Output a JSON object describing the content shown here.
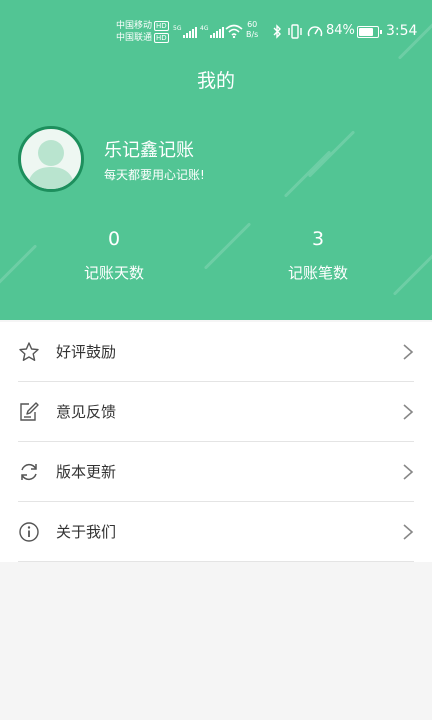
{
  "status_bar": {
    "carrier1": "中国移动",
    "carrier2": "中国联通",
    "hd_badge": "HD",
    "signal1_tag": "5G",
    "signal2_tag": "4G",
    "net_speed_value": "60",
    "net_speed_unit": "B/s",
    "battery_percent": "84%",
    "battery_level": 0.84,
    "time": "3:54",
    "icons": [
      "wifi-icon",
      "bluetooth-icon",
      "vibrate-icon",
      "speedometer-icon",
      "battery-icon"
    ]
  },
  "header": {
    "title": "我的",
    "background_color": "#52c594",
    "avatar_border_color": "#1d8f5d"
  },
  "profile": {
    "app_name": "乐记鑫记账",
    "slogan": "每天都要用心记账!"
  },
  "stats": [
    {
      "value": "0",
      "label": "记账天数"
    },
    {
      "value": "3",
      "label": "记账笔数"
    }
  ],
  "menu": [
    {
      "icon": "star-icon",
      "label": "好评鼓励"
    },
    {
      "icon": "feedback-icon",
      "label": "意见反馈"
    },
    {
      "icon": "refresh-icon",
      "label": "版本更新"
    },
    {
      "icon": "info-icon",
      "label": "关于我们"
    }
  ]
}
